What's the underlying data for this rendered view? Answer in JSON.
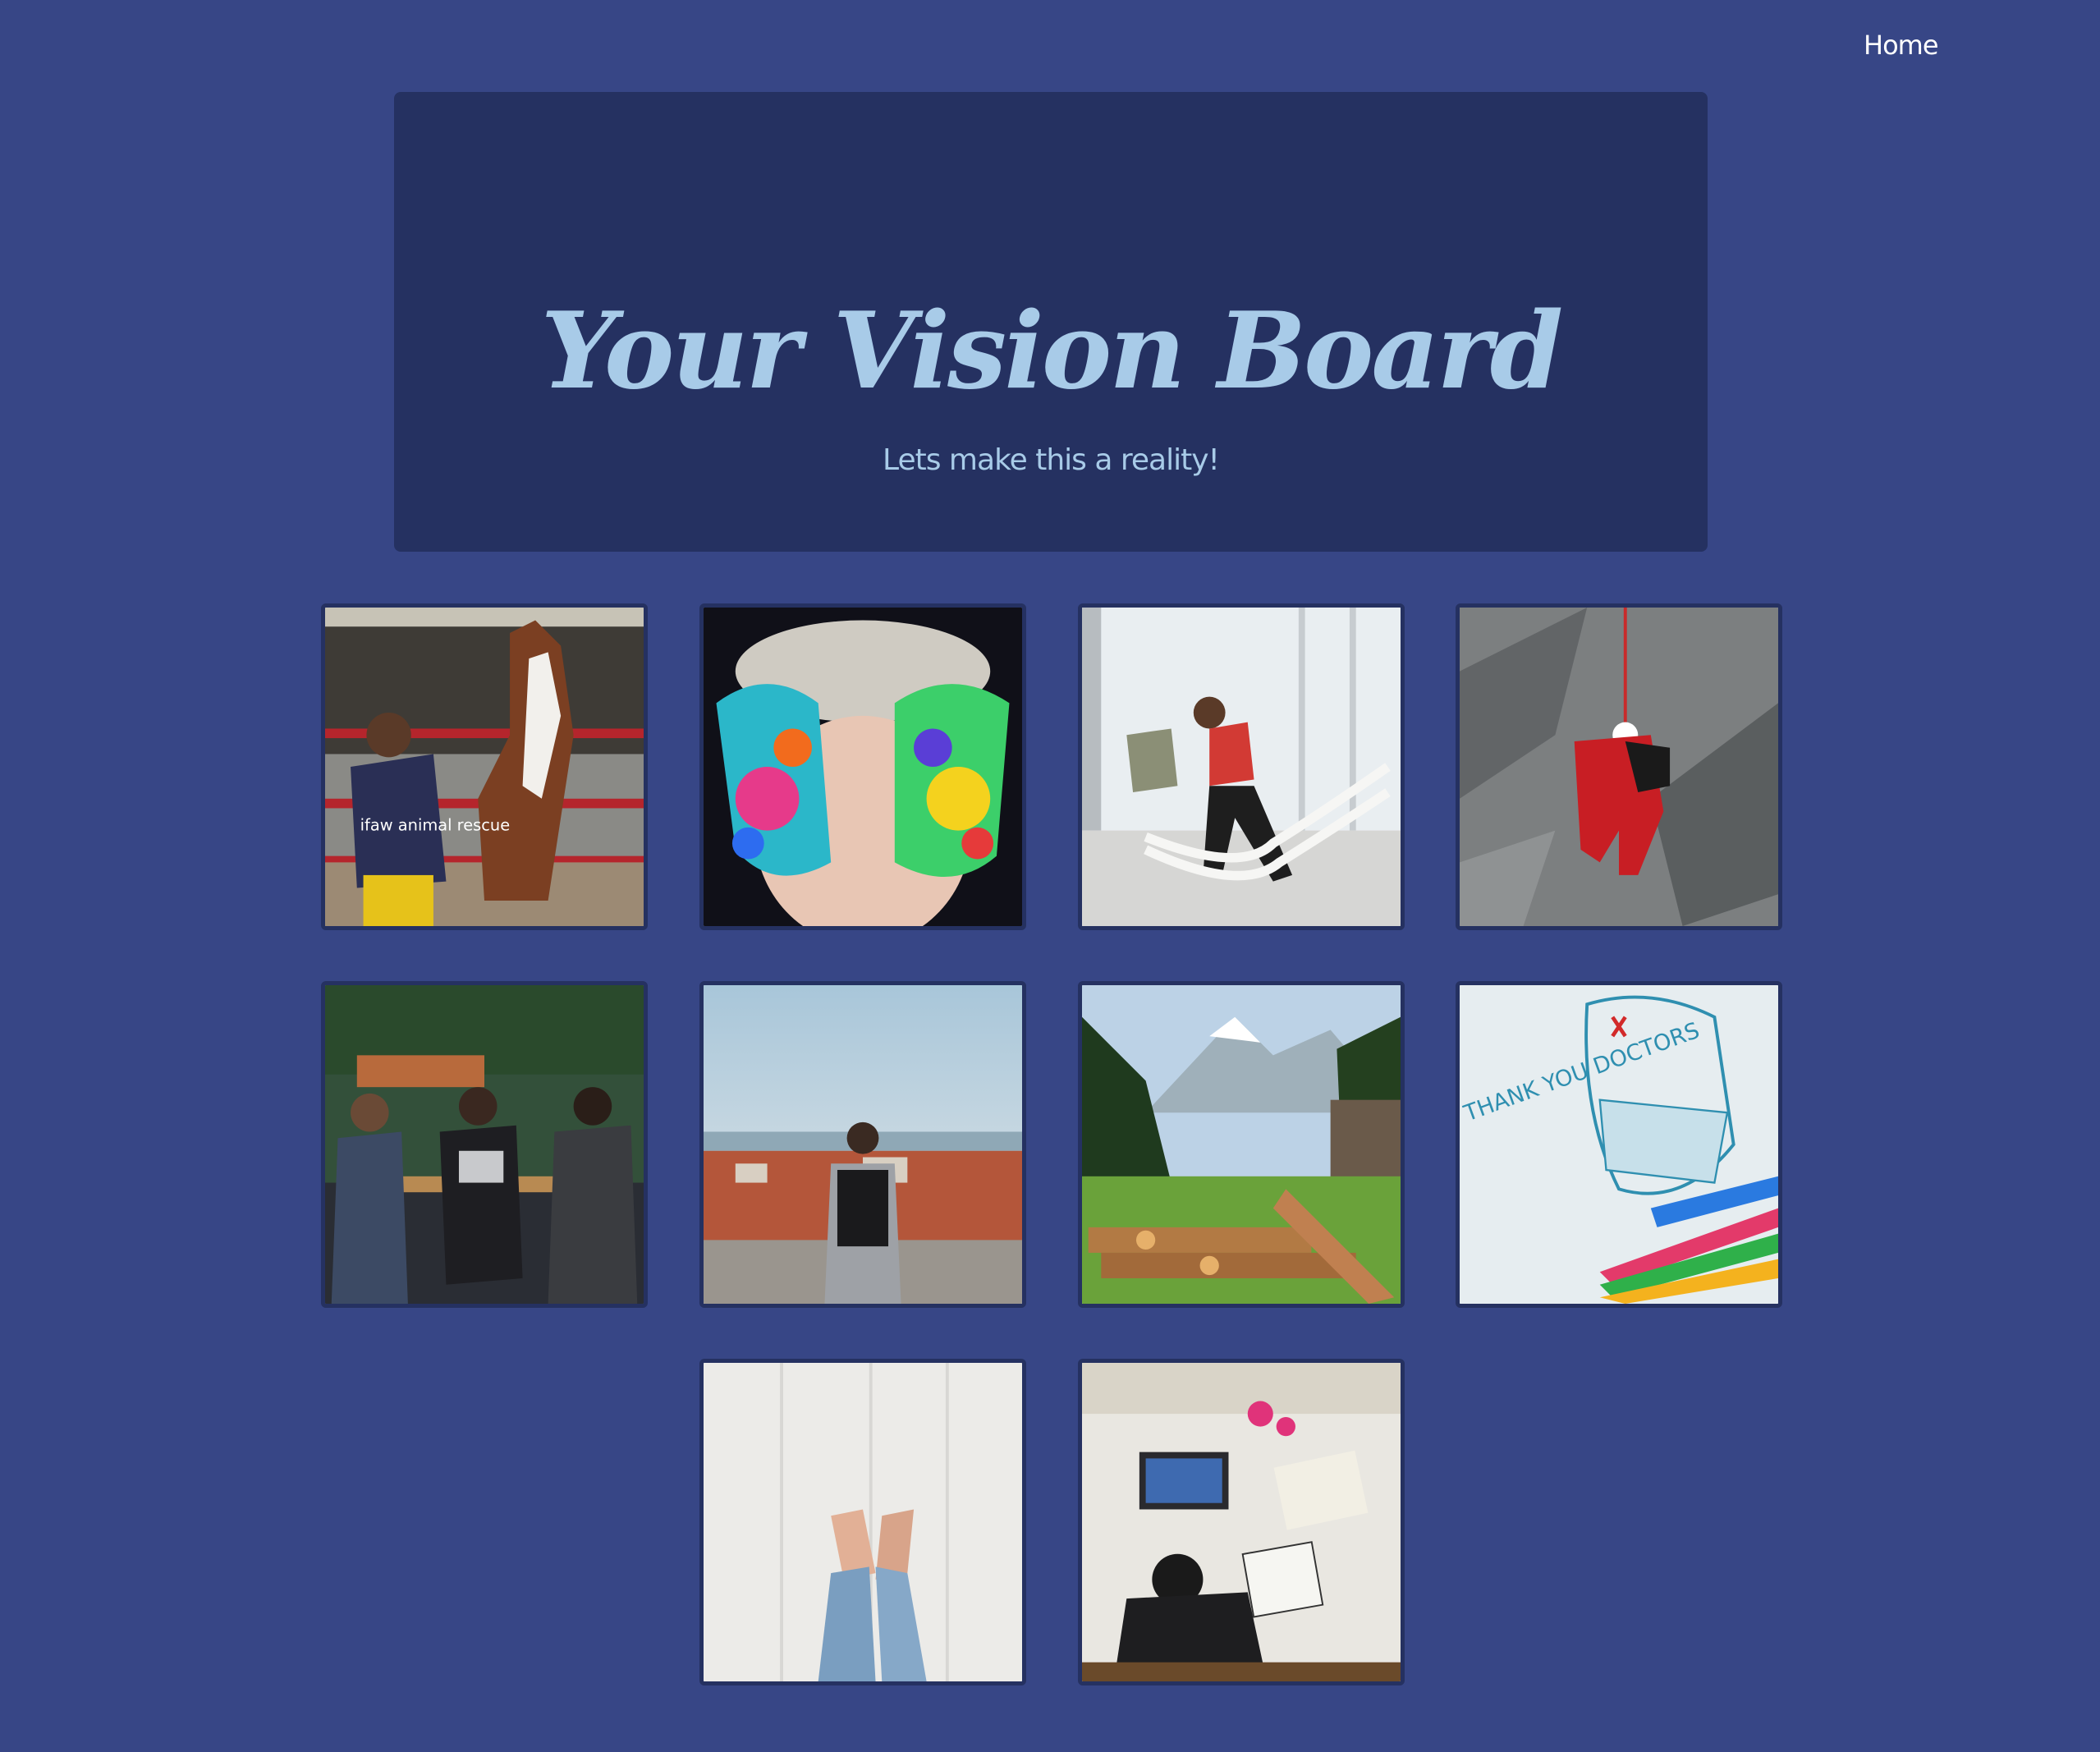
{
  "nav": {
    "home_label": "Home"
  },
  "hero": {
    "title": "Your Vision Board",
    "subtitle": "Lets make this a reality!"
  },
  "board": {
    "tiles": [
      {
        "subject": "woman-with-horse-photo",
        "shirt_text": "ifaw animal rescue"
      },
      {
        "subject": "painted-hands-photo"
      },
      {
        "subject": "battle-ropes-training-photo"
      },
      {
        "subject": "mountain-rescue-photo"
      },
      {
        "subject": "friends-at-cafe-photo"
      },
      {
        "subject": "traveler-overlooking-city-photo"
      },
      {
        "subject": "mountain-meadow-logs-photo"
      },
      {
        "subject": "thank-you-doctors-drawing",
        "drawing_text": "THANK YOU DOCTORS"
      },
      {
        "subject": "crossed-feet-photo"
      },
      {
        "subject": "artist-desk-photo"
      }
    ]
  },
  "colors": {
    "page_bg": "#374686",
    "hero_bg": "#253161",
    "accent_text": "#a8cbe8",
    "tile_border": "#253161"
  }
}
